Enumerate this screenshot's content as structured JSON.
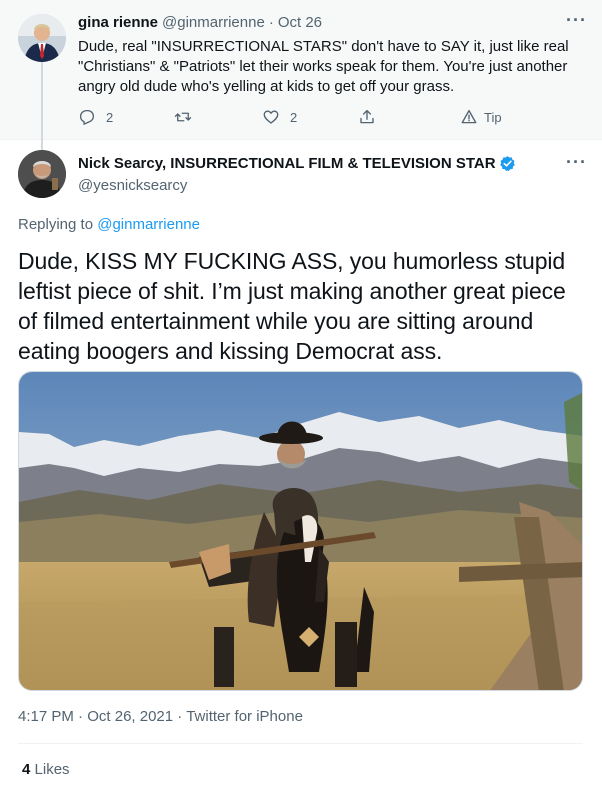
{
  "reply": {
    "display_name": "gina rienne",
    "handle": "@ginmarrienne",
    "separator": "·",
    "date": "Oct 26",
    "body_lines": [
      "Dude, real \"INSURRECTIONAL STARS\" don't have to SAY it,  just like real",
      "\"Christians\" & \"Patriots\" let their works speak for them. You're just another",
      "angry old dude who's yelling at kids to get off your grass."
    ],
    "replies_count": "2",
    "likes_count": "2",
    "tip_label": "Tip",
    "more": "···"
  },
  "tweet": {
    "display_name": "Nick Searcy, INSURRECTIONAL FILM & TELEVISION STAR",
    "handle": "@yesnicksearcy",
    "more": "···",
    "replying_prefix": "Replying to",
    "replying_handle": "@ginmarrienne",
    "text_lines": [
      "Dude, KISS MY FUCKING ASS, you humorless stupid",
      "leftist piece of shit. I’m just making another great piece",
      "of filmed entertainment while you are sitting around",
      "eating boogers and kissing Democrat ass."
    ],
    "time": "4:17 PM",
    "date": "Oct 26, 2021",
    "separator": "·",
    "source": "Twitter for iPhone",
    "likes_count": "4",
    "likes_label": "Likes"
  },
  "icons": {
    "reply": "reply-icon",
    "retweet": "retweet-icon",
    "like": "heart-icon",
    "share": "share-icon",
    "tip": "tip-icon",
    "verified": "verified-badge-icon"
  },
  "colors": {
    "accent": "#1d9bf0",
    "text": "#0f1419",
    "muted": "#536471",
    "reply_bg": "#f7f9f9"
  }
}
